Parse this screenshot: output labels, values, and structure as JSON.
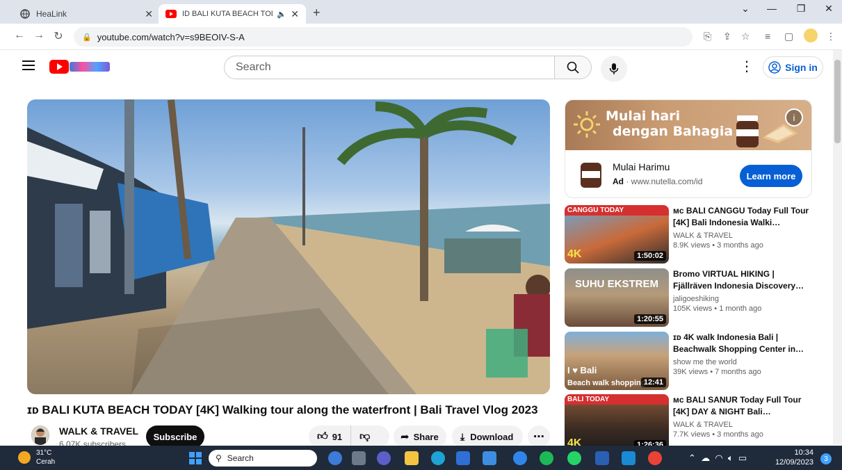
{
  "browser": {
    "tabs": [
      {
        "label": "HeaLink",
        "active": false
      },
      {
        "label": "ID BALI KUTA BEACH TODAY",
        "active": true
      }
    ],
    "url": "youtube.com/watch?v=s9BEOIV-S-A",
    "new_tab_symbol": "+"
  },
  "yt": {
    "search_placeholder": "Search",
    "sign_in": "Sign in",
    "video": {
      "title": "ɪᴅ BALI KUTA BEACH TODAY [4K] Walking tour along the waterfront | Bali Travel Vlog 2023",
      "channel": "WALK & TRAVEL",
      "subscribers": "6.07K subscribers",
      "subscribe": "Subscribe",
      "likes": "91",
      "share": "Share",
      "download": "Download"
    },
    "ad": {
      "banner_line1": "Mulai hari",
      "banner_line2": "dengan Bahagia",
      "title": "Mulai Harimu",
      "ad_label": "Ad",
      "domain": "www.nutella.com/id",
      "cta": "Learn more"
    },
    "recommendations": [
      {
        "title": "ᴍᴄ BALI CANGGU Today Full Tour [4K] Bali Indonesia Walki…",
        "channel": "WALK & TRAVEL",
        "meta": "8.9K views • 3 months ago",
        "duration": "1:50:02",
        "overlay": "CANGGU TODAY",
        "badge": "4K"
      },
      {
        "title": "Bromo VIRTUAL HIKING | Fjällräven Indonesia Discovery…",
        "channel": "jaligoeshiking",
        "meta": "105K views • 1 month ago",
        "duration": "1:20:55",
        "overlay": "SUHU EKSTREM"
      },
      {
        "title": "ɪᴅ 4K walk Indonesia Bali | Beachwalk Shopping Center in…",
        "channel": "show me the world",
        "meta": "39K views • 7 months ago",
        "duration": "12:41",
        "overlay": "I ♥ Bali",
        "overlay_bottom": "Beach walk shopping"
      },
      {
        "title": "ᴍᴄ BALI SANUR Today Full Tour [4K] DAY & NIGHT Bali…",
        "channel": "WALK & TRAVEL",
        "meta": "7.7K views • 3 months ago",
        "duration": "1:26:36",
        "overlay": "BALI TODAY",
        "badge": "4K"
      }
    ]
  },
  "taskbar": {
    "weather_temp": "31°C",
    "weather_desc": "Cerah",
    "search": "Search",
    "time": "10:34",
    "date": "12/09/2023",
    "notifications": "3"
  },
  "colors": {
    "yt_red": "#ff0000",
    "link_blue": "#065fd4",
    "taskbar": "#1f2a3a"
  }
}
